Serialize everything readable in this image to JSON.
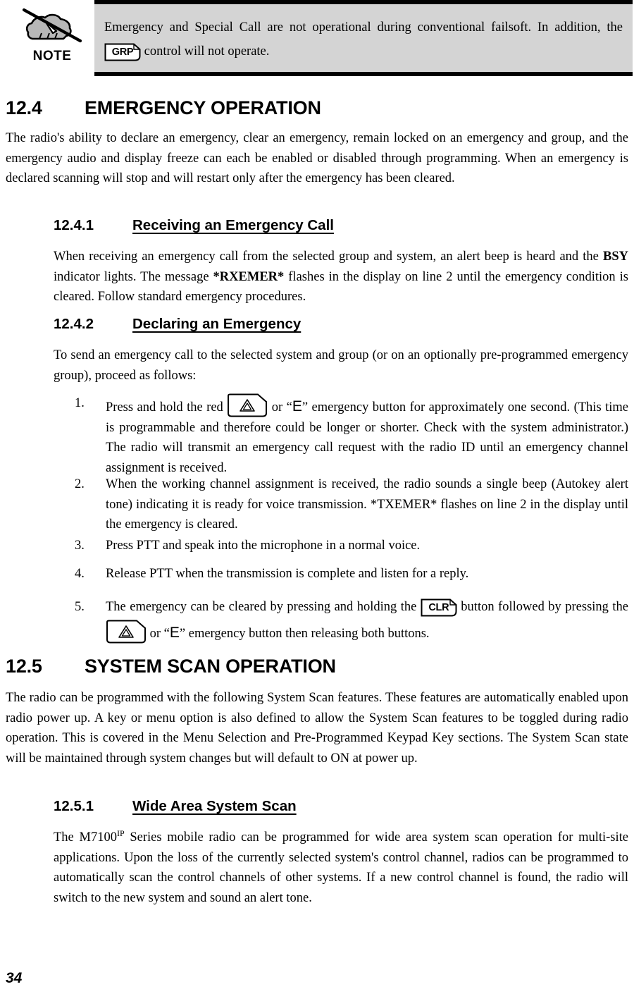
{
  "note": {
    "icon_name": "hand-with-pencil-crossed-out-icon",
    "label": "NOTE",
    "text_before_key": "Emergency and Special Call are not operational during conventional failsoft. In addition, the ",
    "key_label": "GRP",
    "text_after_key": " control will not operate."
  },
  "sections": {
    "s124": {
      "number": "12.4",
      "title": "EMERGENCY OPERATION",
      "intro": "The radio's ability to declare an emergency, clear an emergency, remain locked on an emergency and group, and the emergency audio and display freeze can each be enabled or disabled through programming. When an emergency is declared scanning will stop and will restart only after the emergency has been cleared."
    },
    "s1241": {
      "number": "12.4.1",
      "title": "Receiving an Emergency Call",
      "p1_a": "When receiving an emergency call from the selected group and system, an alert beep is heard and the ",
      "p1_bold1": "BSY",
      "p1_b": " indicator lights.  The message ",
      "p1_bold2": "*RXEMER*",
      "p1_c": " flashes in the display on line 2 until the emergency condition is cleared. Follow standard emergency procedures."
    },
    "s1242": {
      "number": "12.4.2",
      "title": "Declaring an Emergency",
      "intro": "To send an emergency call to the selected system and group (or on an optionally pre-programmed emergency group), proceed as follows:",
      "steps": [
        {
          "marker": "1.",
          "a": "Press and hold the red ",
          "key": "emergency-triangle",
          "b": " or “",
          "e": "E",
          "c": "” emergency button for approximately one second. (This time is programmable and therefore could be longer or shorter. Check with the system administrator.) The radio will transmit an emergency call request with the radio ID until an emergency channel assignment is received."
        },
        {
          "marker": "2.",
          "a": "When the working channel assignment is received, the radio sounds a single beep (Autokey alert tone) indicating it is ready for voice transmission. *TXEMER* flashes on line 2 in the display until the emergency is cleared."
        },
        {
          "marker": "3.",
          "a": "Press PTT and speak into the microphone in a normal voice."
        },
        {
          "marker": "4.",
          "a": "Release PTT when the transmission is complete and listen for a reply."
        },
        {
          "marker": "5.",
          "a": "The emergency can be cleared by pressing and holding the ",
          "key1": "CLR",
          "b": " button followed by pressing the ",
          "key2": "emergency-triangle",
          "c": " or “",
          "e": "E",
          "d": "” emergency button then releasing both buttons."
        }
      ]
    },
    "s125": {
      "number": "12.5",
      "title": "SYSTEM SCAN OPERATION",
      "intro": "The radio can be programmed with the following System Scan features. These features are automatically enabled upon radio power up. A key or menu option is also defined to allow the System Scan features to be toggled during radio operation. This is covered in the Menu Selection and Pre-Programmed Keypad Key sections. The System Scan state will be maintained through system changes but will default to ON at power up."
    },
    "s1251": {
      "number": "12.5.1",
      "title": "Wide Area System Scan",
      "p_a": "The M7100",
      "p_sup": "IP",
      "p_b": " Series mobile radio can be programmed for wide area system scan operation for multi-site applications. Upon the loss of the currently selected system's control channel, radios can be programmed to automatically scan the control channels of other systems. If a new control channel is found, the radio will switch to the new system and sound an alert tone."
    }
  },
  "footer": {
    "page_number": "34"
  },
  "colors": {
    "note_background": "#d4d4d4",
    "rule": "#000000",
    "text": "#000000"
  }
}
